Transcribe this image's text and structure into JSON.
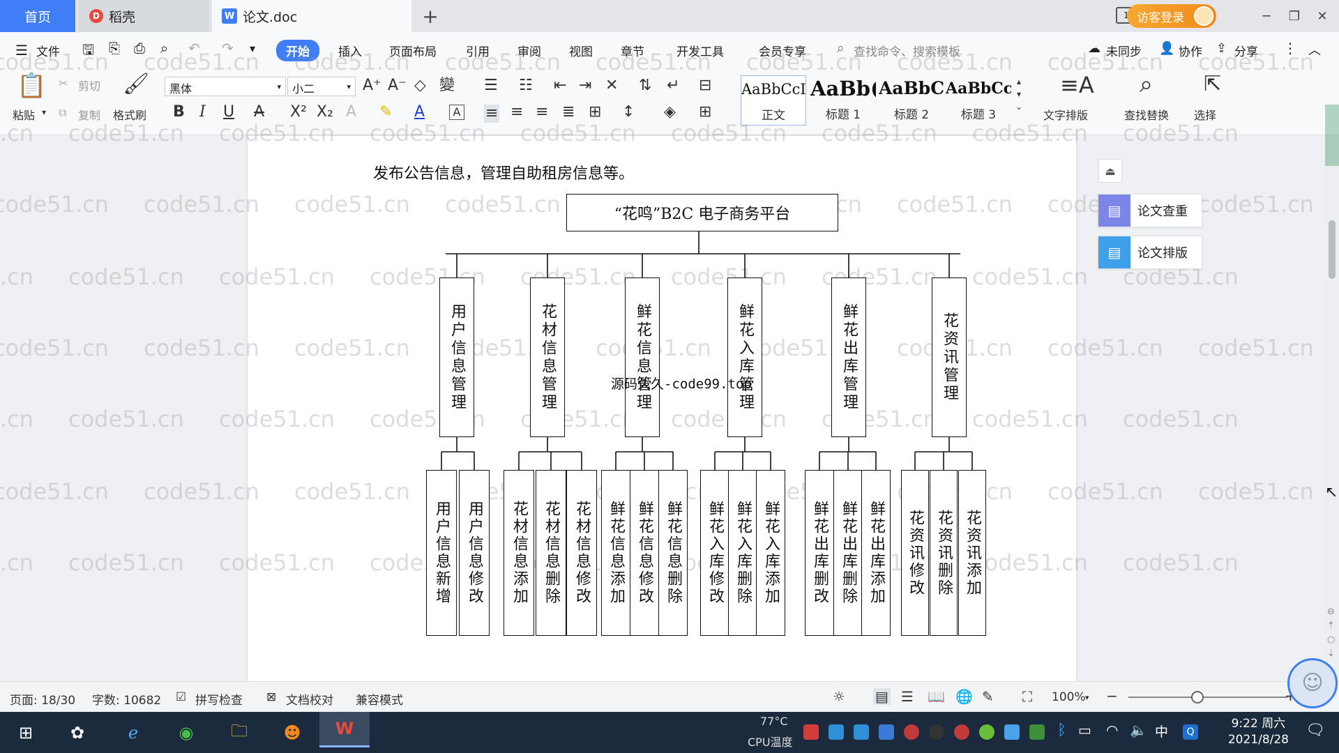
{
  "tabs": {
    "home": "首页",
    "docer": "稻壳",
    "doc": "论文.doc",
    "add": "+"
  },
  "account": {
    "login_label": "访客登录"
  },
  "menu": {
    "file": "文件",
    "items": [
      "开始",
      "插入",
      "页面布局",
      "引用",
      "审阅",
      "视图",
      "章节",
      "开发工具",
      "会员专享"
    ],
    "search_placeholder": "查找命令、搜索模板",
    "sync": "未同步",
    "collab": "协作",
    "share": "分享"
  },
  "ribbon": {
    "paste": "粘贴",
    "cut": "剪切",
    "copy": "复制",
    "format_painter": "格式刷",
    "font_name": "黑体",
    "font_size": "小二",
    "styles": [
      {
        "preview": "AaBbCcI",
        "name": "正文"
      },
      {
        "preview": "AaBb(",
        "name": "标题 1"
      },
      {
        "preview": "AaBbC",
        "name": "标题 2"
      },
      {
        "preview": "AaBbCcl",
        "name": "标题 3"
      }
    ],
    "text_layout": "文字排版",
    "find_replace": "查找替换",
    "select": "选择"
  },
  "document": {
    "paragraph": "发布公告信息，管理自助租房信息等。",
    "diagram": {
      "root": "“花鸣”B2C 电子商务平台",
      "modules": [
        {
          "label": "用户信息管理",
          "children": [
            "用户信息新增",
            "用户信息修改"
          ]
        },
        {
          "label": "花材信息管理",
          "children": [
            "花材信息添加",
            "花材信息删除",
            "花材信息修改"
          ]
        },
        {
          "label": "鲜花信息管理",
          "children": [
            "鲜花信息添加",
            "鲜花信息修改",
            "鲜花信息删除"
          ]
        },
        {
          "label": "鲜花入库管理",
          "children": [
            "鲜花入库修改",
            "鲜花入库删除",
            "鲜花入库添加"
          ]
        },
        {
          "label": "鲜花出库管理",
          "children": [
            "鲜花出库删改",
            "鲜花出库删除",
            "鲜花出库添加"
          ]
        },
        {
          "label": "花资讯管理",
          "children": [
            "花资讯修改",
            "花资讯删除",
            "花资讯添加"
          ]
        }
      ]
    },
    "overlay_text": "源码久久-code99.top",
    "watermark": "code51.cn"
  },
  "side_panel": {
    "check": "论文查重",
    "layout": "论文排版"
  },
  "status": {
    "page": "页面: 18/30",
    "words": "字数: 10682",
    "spellcheck": "拼写检查",
    "proofread": "文档校对",
    "compat": "兼容模式",
    "zoom": "100%"
  },
  "taskbar": {
    "temp": "77°C",
    "temp_label": "CPU温度",
    "time": "9:22 周六",
    "date": "2021/8/28",
    "ime": "中"
  },
  "colors": {
    "accent": "#3f7ef6",
    "visitor": "#f39a24",
    "taskbar": "#1c2a3d"
  }
}
